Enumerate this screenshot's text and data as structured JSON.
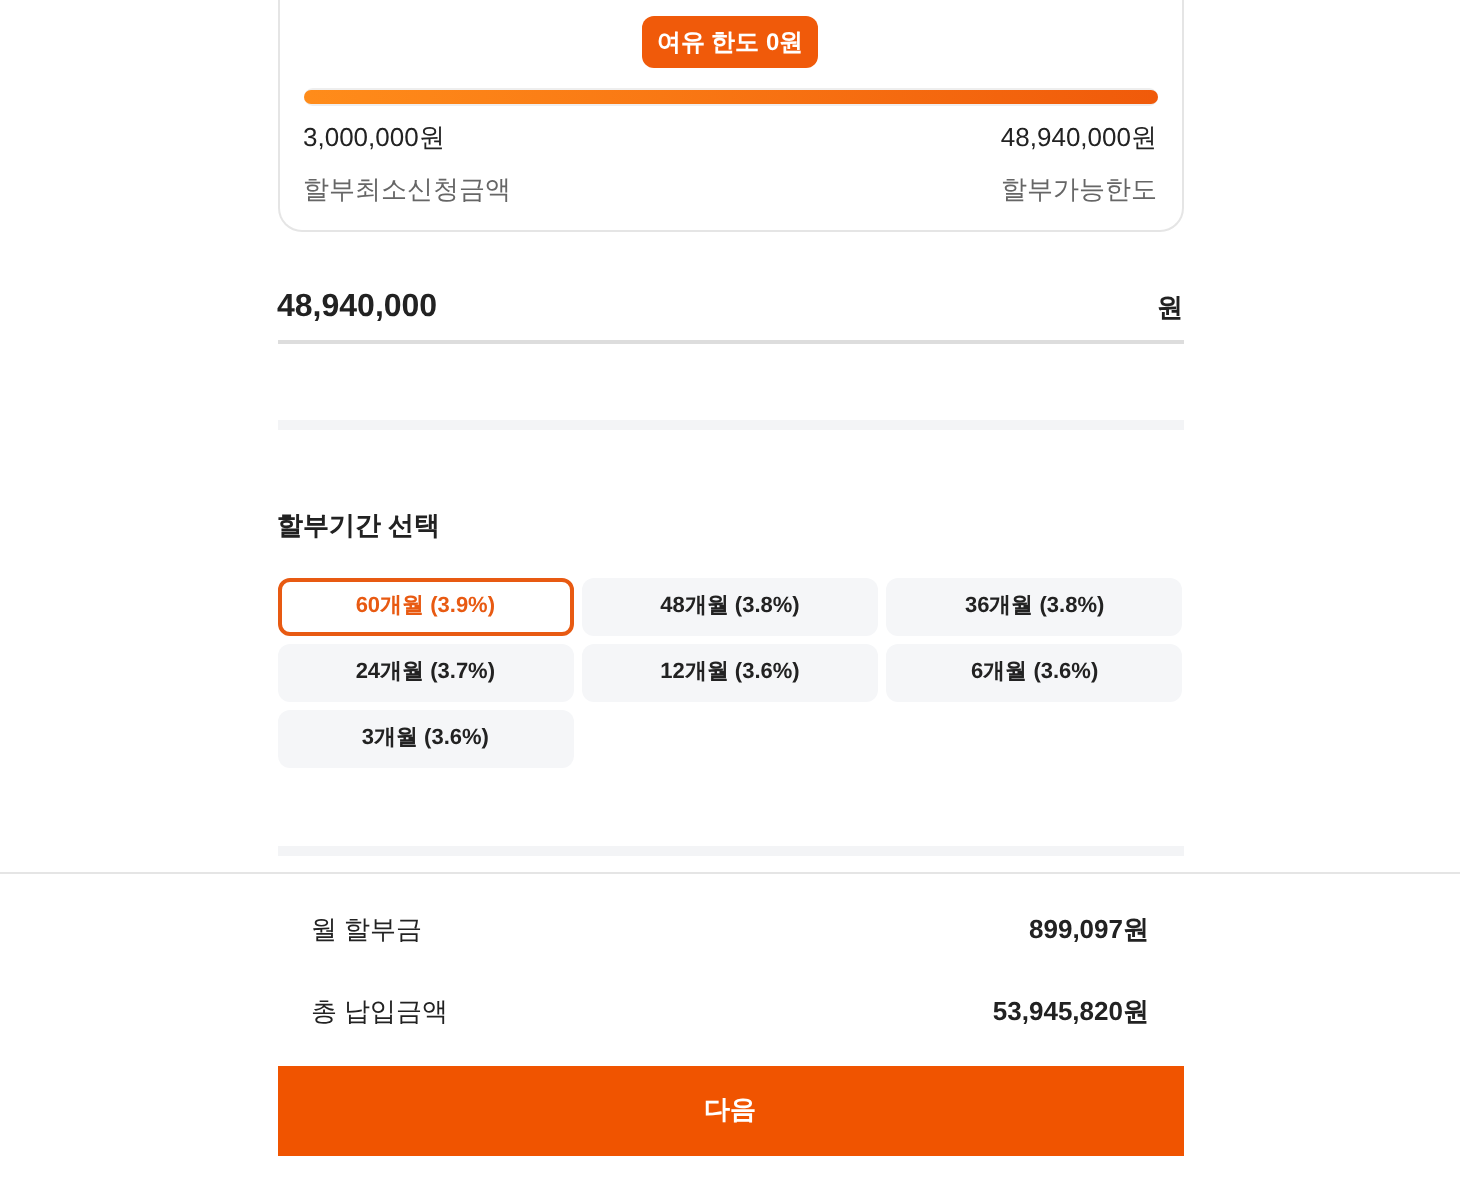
{
  "limit_card": {
    "badge": "여유 한도 0원",
    "level": 1,
    "min_amount": "3,000,000원",
    "max_amount": "48,940,000원",
    "min_label": "할부최소신청금액",
    "max_label": "할부가능한도"
  },
  "amount_field": {
    "value": "48,940,000",
    "unit": "원"
  },
  "period": {
    "title": "할부기간 선택",
    "options": [
      {
        "label": "60개월 (3.9%)",
        "selected": true
      },
      {
        "label": "48개월 (3.8%)",
        "selected": false
      },
      {
        "label": "36개월 (3.8%)",
        "selected": false
      },
      {
        "label": "24개월 (3.7%)",
        "selected": false
      },
      {
        "label": "12개월 (3.6%)",
        "selected": false
      },
      {
        "label": "6개월 (3.6%)",
        "selected": false
      },
      {
        "label": "3개월 (3.6%)",
        "selected": false
      }
    ]
  },
  "summary": [
    {
      "label": "월 할부금",
      "value": "899,097원"
    },
    {
      "label": "총 납입금액",
      "value": "53,945,820원"
    }
  ],
  "next_button": "다음"
}
